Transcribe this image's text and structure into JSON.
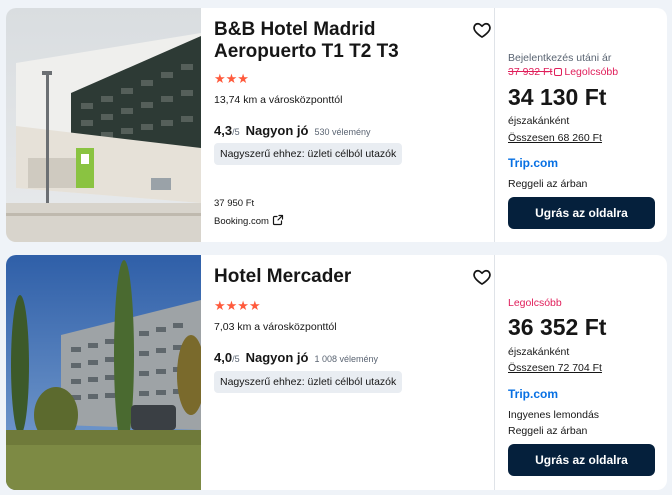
{
  "hotels": [
    {
      "name": "B&B Hotel Madrid Aeropuerto T1 T2 T3",
      "stars": "★★★",
      "star_count": 3,
      "distance": "13,74 km a városközponttól",
      "score": "4,3",
      "score_out_of": "/5",
      "rating_label": "Nagyon jó",
      "reviews": "530 vélemény",
      "tag": "Nagyszerű ehhez: üzleti célból utazók",
      "alt_price": "37 950 Ft",
      "alt_provider": "Booking.com",
      "alt_provider_icon": "external-link-icon",
      "price_label": "Bejelentkezés utáni ár",
      "old_price": "37 932 Ft",
      "lowest_label": "Legolcsóbb",
      "price": "34 130 Ft",
      "per_night": "éjszakánként",
      "total": "Összesen 68 260 Ft",
      "provider": "Trip.com",
      "notes": [
        "Reggeli az árban"
      ],
      "button": "Ugrás az oldalra"
    },
    {
      "name": "Hotel Mercader",
      "stars": "★★★★",
      "star_count": 4,
      "distance": "7,03 km a városközponttól",
      "score": "4,0",
      "score_out_of": "/5",
      "rating_label": "Nagyon jó",
      "reviews": "1 008 vélemény",
      "tag": "Nagyszerű ehhez: üzleti célból utazók",
      "lowest_label": "Legolcsóbb",
      "price": "36 352 Ft",
      "per_night": "éjszakánként",
      "total": "Összesen 72 704 Ft",
      "provider": "Trip.com",
      "notes": [
        "Ingyenes lemondás",
        "Reggeli az árban"
      ],
      "button": "Ugrás az oldalra"
    }
  ],
  "icons": {
    "favorite": "heart-outline-icon",
    "external": "external-link-icon"
  },
  "colors": {
    "accent_pink": "#e01e5a",
    "star": "#ff5a3c",
    "provider_blue": "#0770e3",
    "button_navy": "#05203c"
  }
}
